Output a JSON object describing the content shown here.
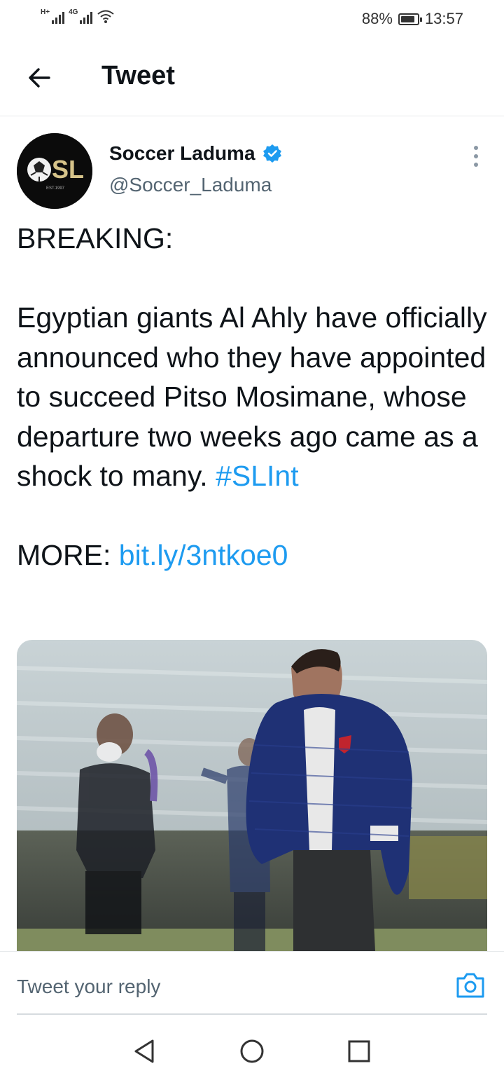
{
  "status_bar": {
    "network_1": "H+",
    "network_2": "4G",
    "battery_percent": "88%",
    "battery_level": 0.88,
    "time": "13:57"
  },
  "header": {
    "title": "Tweet",
    "back_icon": "arrow-left-icon"
  },
  "tweet": {
    "author_name": "Soccer Laduma",
    "verified": true,
    "handle": "@Soccer_Laduma",
    "avatar_text": "SL",
    "avatar_subtext": "EST.1997",
    "text_before": "BREAKING:\n\nEgyptian giants Al Ahly have officially announced who they have appointed to succeed Pitso Mosimane, whose departure two weeks ago came as a shock to many. ",
    "hashtag": "#SLInt",
    "text_mid": "\n\nMORE: ",
    "link": "bit.ly/3ntkoe0",
    "media_alt_icon": "photo"
  },
  "reply": {
    "placeholder": "Tweet your reply",
    "camera_icon": "camera-icon"
  },
  "nav": {
    "back_icon": "triangle-back-icon",
    "home_icon": "circle-home-icon",
    "recents_icon": "square-recents-icon"
  },
  "colors": {
    "link": "#1d9bf0",
    "text": "#0f1419",
    "secondary": "#536471"
  }
}
